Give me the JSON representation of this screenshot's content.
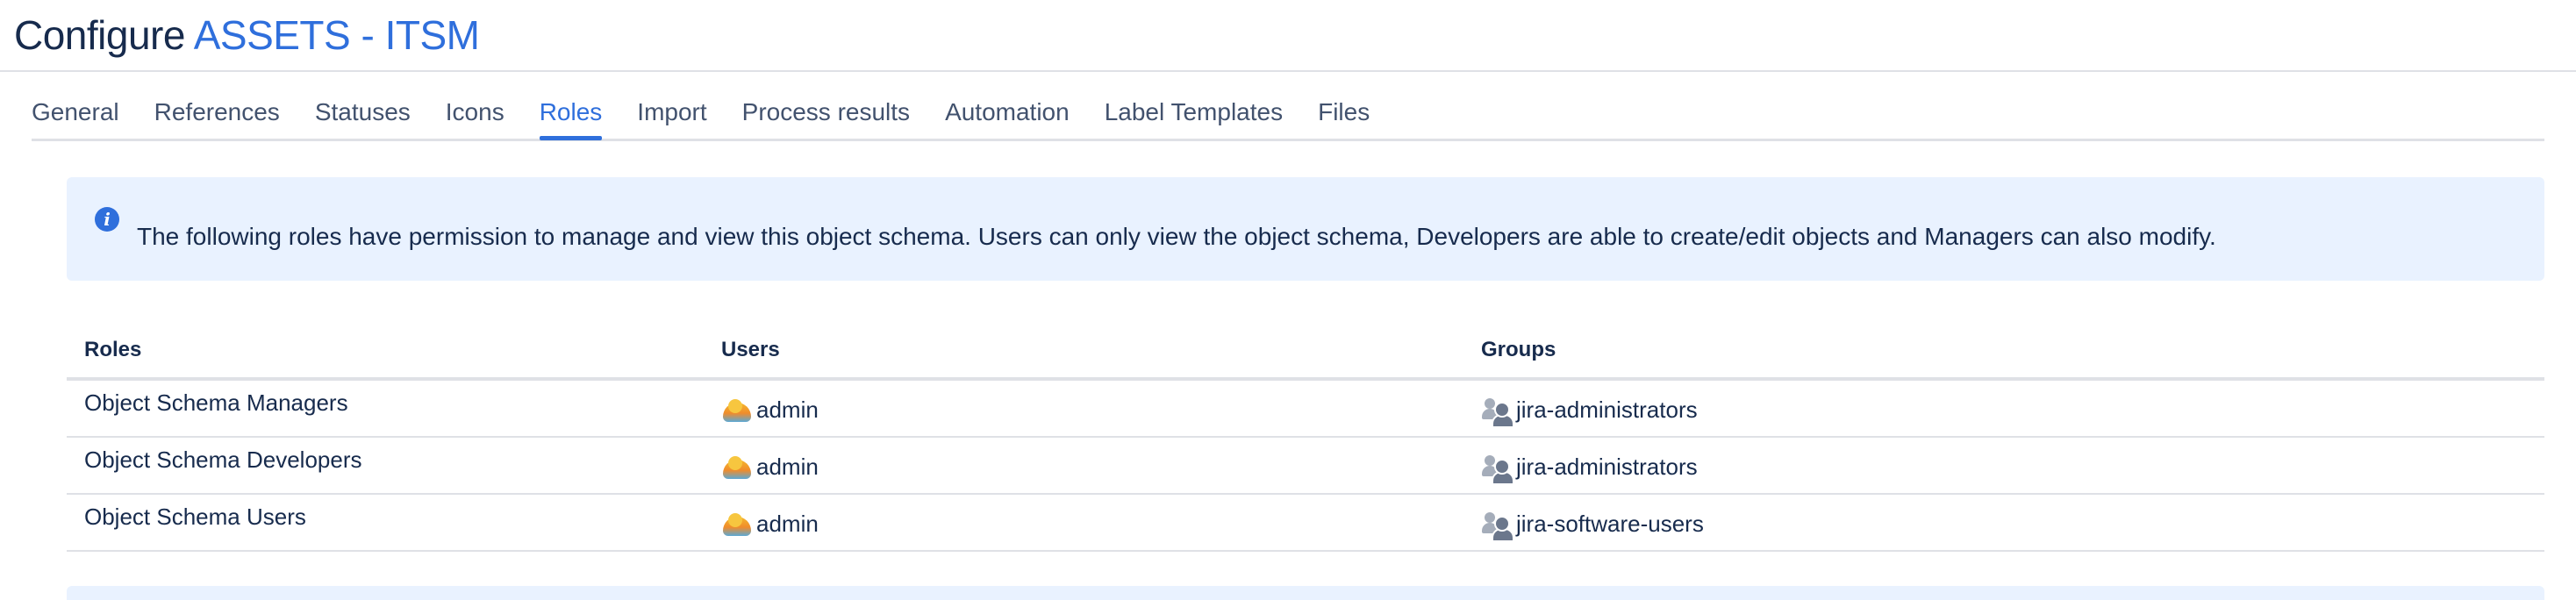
{
  "header": {
    "title_prefix": "Configure",
    "title_project": "ASSETS - ITSM"
  },
  "tabs": [
    {
      "label": "General",
      "active": false
    },
    {
      "label": "References",
      "active": false
    },
    {
      "label": "Statuses",
      "active": false
    },
    {
      "label": "Icons",
      "active": false
    },
    {
      "label": "Roles",
      "active": true
    },
    {
      "label": "Import",
      "active": false
    },
    {
      "label": "Process results",
      "active": false
    },
    {
      "label": "Automation",
      "active": false
    },
    {
      "label": "Label Templates",
      "active": false
    },
    {
      "label": "Files",
      "active": false
    }
  ],
  "info": {
    "icon": "info-icon",
    "text": "The following roles have permission to manage and view this object schema. Users can only view the object schema, Developers are able to create/edit objects and Managers can also modify."
  },
  "table": {
    "headers": {
      "roles": "Roles",
      "users": "Users",
      "groups": "Groups"
    },
    "rows": [
      {
        "role": "Object Schema Managers",
        "user": "admin",
        "group": "jira-administrators"
      },
      {
        "role": "Object Schema Developers",
        "user": "admin",
        "group": "jira-administrators"
      },
      {
        "role": "Object Schema Users",
        "user": "admin",
        "group": "jira-software-users"
      }
    ]
  },
  "colors": {
    "accent": "#2f6fdc",
    "info_bg": "#e9f2ff",
    "text": "#172b4d",
    "muted": "#42526e"
  }
}
